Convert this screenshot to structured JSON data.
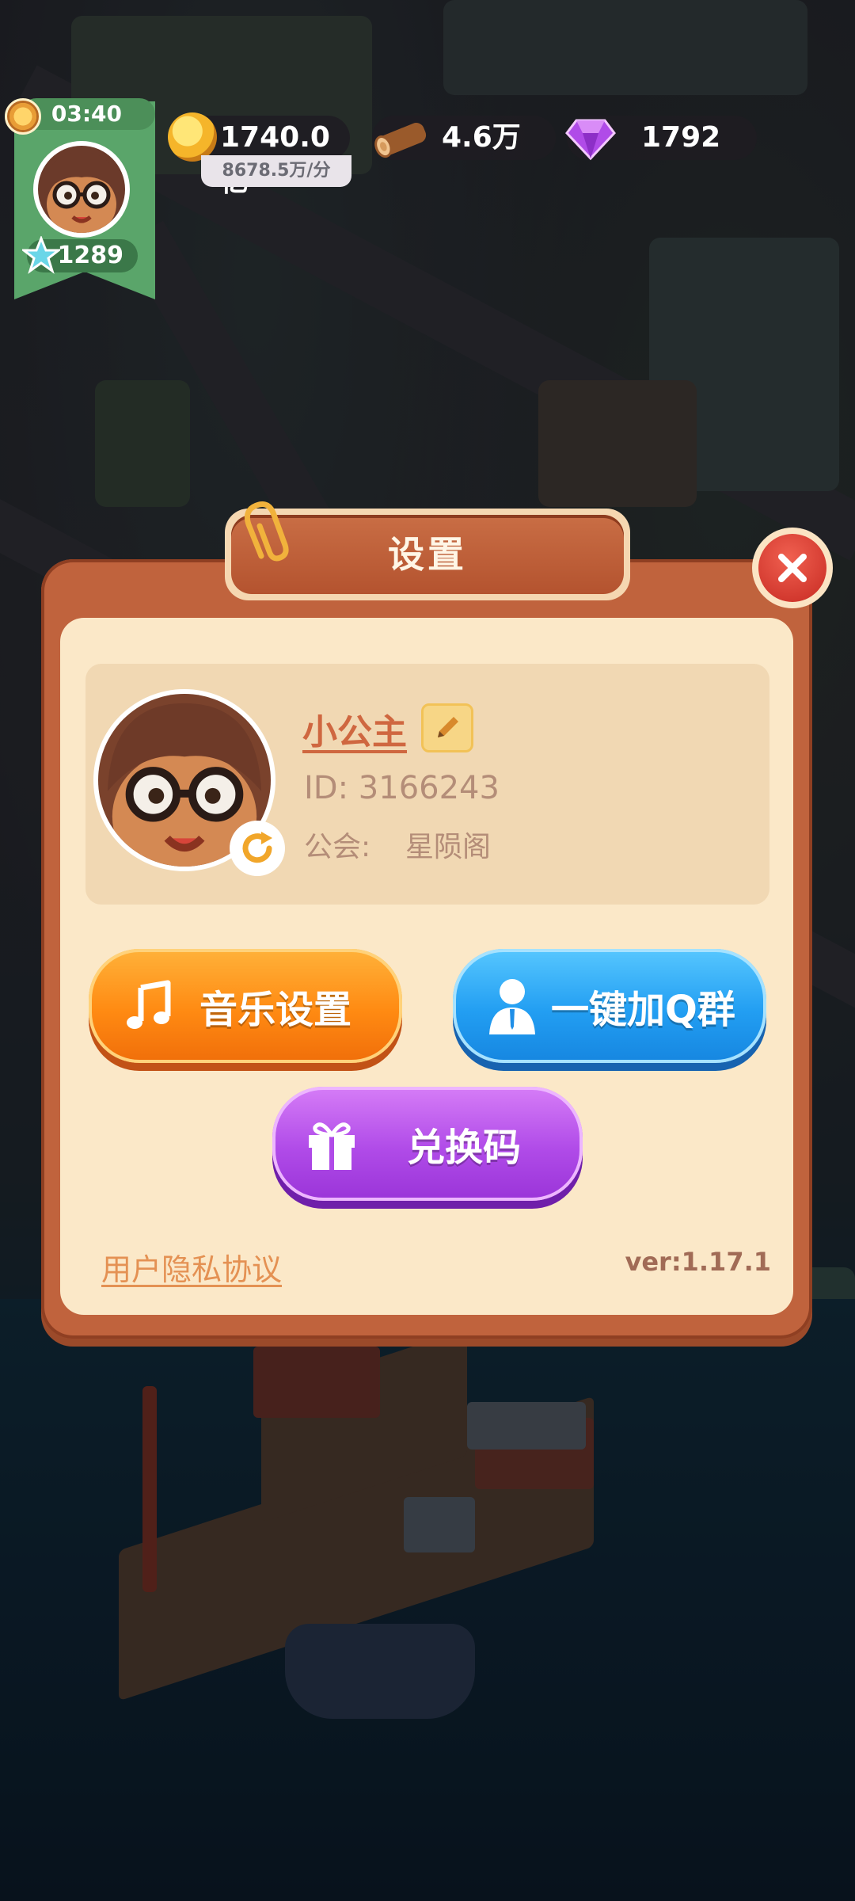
{
  "hud": {
    "timer": "03:40",
    "level": "1289",
    "coins": "1740.0亿",
    "coin_rate": "8678.5万/分",
    "wood": "4.6万",
    "gems": "1792"
  },
  "dialog": {
    "title": "设置",
    "profile": {
      "name": "小公主",
      "id_text": "ID: 3166243",
      "guild_label": "公会:",
      "guild_name": "星陨阁"
    },
    "buttons": {
      "music": "音乐设置",
      "qq_group": "一键加Q群",
      "redeem": "兑换码"
    },
    "privacy_link": "用户隐私协议",
    "version": "ver:1.17.1"
  },
  "colors": {
    "panel": "#c0633d",
    "panel_inner": "#fbe8c8",
    "music_button": "#ff8a12",
    "qq_button": "#229ef2",
    "redeem_button": "#b04be8",
    "close_button": "#d93a2e"
  }
}
